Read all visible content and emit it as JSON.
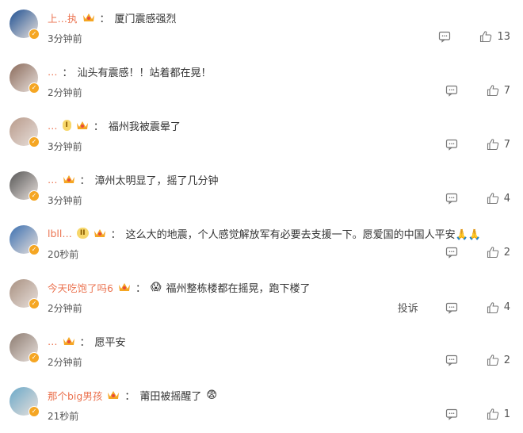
{
  "comments": [
    {
      "user": "上…执",
      "text": "厦门震感强烈",
      "time": "3分钟前",
      "likes": "13",
      "avatar_color": "#1d4f91",
      "name_color": "#eb7350",
      "show_crown": true,
      "level_badge": "",
      "emoji": ""
    },
    {
      "user": "…",
      "text": "汕头有震感！！站着都在晃！",
      "time": "2分钟前",
      "likes": "7",
      "avatar_color": "#8a6a5a",
      "name_color": "#eb7350",
      "show_crown": false,
      "level_badge": "",
      "emoji": ""
    },
    {
      "user": "…",
      "text": "福州我被震晕了",
      "time": "3分钟前",
      "likes": "7",
      "avatar_color": "#b89a8a",
      "name_color": "#eb7350",
      "show_crown": true,
      "level_badge": "I",
      "emoji": ""
    },
    {
      "user": "…",
      "text": "漳州太明显了，摇了几分钟",
      "time": "3分钟前",
      "likes": "4",
      "avatar_color": "#555555",
      "name_color": "#eb7350",
      "show_crown": true,
      "level_badge": "",
      "emoji": ""
    },
    {
      "user": "lbll…",
      "text": "这么大的地震，个人感觉解放军有必要去支援一下。愿爱国的中国人平安🙏🙏",
      "time": "20秒前",
      "likes": "2",
      "avatar_color": "#3a6fb0",
      "name_color": "#eb7350",
      "show_crown": true,
      "level_badge": "II",
      "emoji": ""
    },
    {
      "user": "今天吃饱了吗6",
      "text": "福州整栋楼都在摇晃，跑下楼了",
      "time": "2分钟前",
      "likes": "4",
      "avatar_color": "#a89080",
      "name_color": "#eb7350",
      "show_crown": true,
      "level_badge": "",
      "emoji": "😱",
      "report": "投诉"
    },
    {
      "user": "…",
      "text": "愿平安",
      "time": "2分钟前",
      "likes": "2",
      "avatar_color": "#8c7b70",
      "name_color": "#eb7350",
      "show_crown": true,
      "level_badge": "",
      "emoji": ""
    },
    {
      "user": "那个big男孩",
      "text": "莆田被摇醒了",
      "time": "21秒前",
      "likes": "1",
      "avatar_color": "#6aa8c8",
      "name_color": "#eb7350",
      "show_crown": true,
      "level_badge": "",
      "emoji": "",
      "trailing_emoji": "😨"
    }
  ],
  "colors": {
    "accent": "#eb7350",
    "text": "#333333",
    "meta": "#555555"
  },
  "icons": {
    "comment": "comment-bubble-icon",
    "like": "thumbs-up-icon",
    "crown": "crown-icon"
  }
}
